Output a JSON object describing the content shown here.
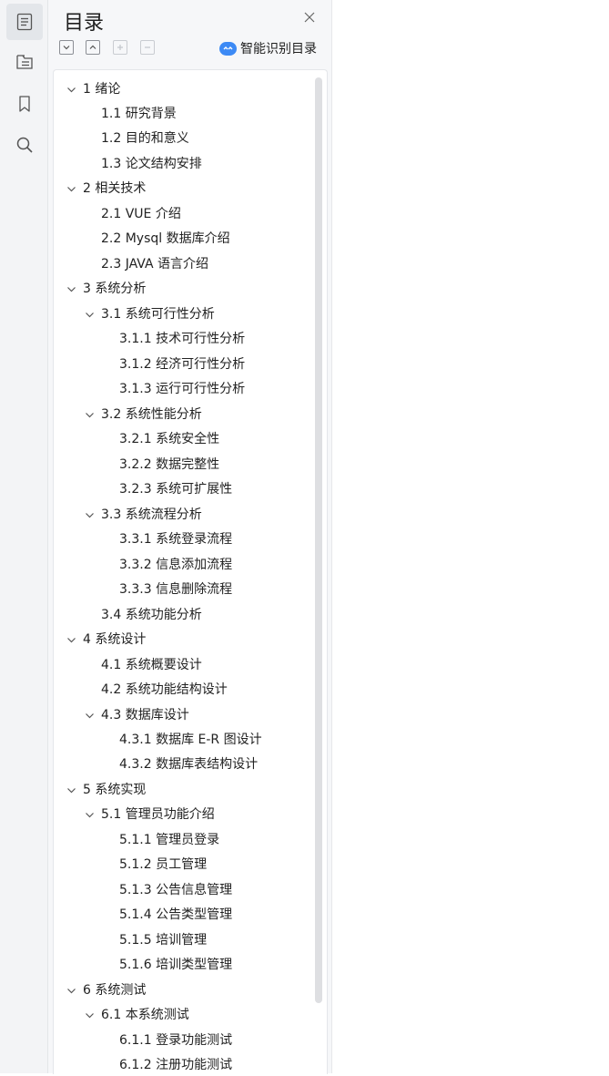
{
  "panel": {
    "title": "目录",
    "ai_label": "智能识别目录",
    "tools": [
      "collapse-all",
      "expand-all",
      "add-entry",
      "remove-entry"
    ]
  },
  "rail": [
    "outline-icon",
    "thumbnail-icon",
    "bookmark-icon",
    "search-icon"
  ],
  "colors": {
    "accent": "#3c8af5",
    "rail_bg": "#f3f4f6",
    "panel_bg": "#f6f7f9"
  },
  "toc": [
    {
      "label": "1  绪论",
      "level": 0,
      "expandable": true
    },
    {
      "label": "1.1  研究背景",
      "level": 1,
      "expandable": false
    },
    {
      "label": "1.2 目的和意义",
      "level": 1,
      "expandable": false
    },
    {
      "label": "1.3  论文结构安排",
      "level": 1,
      "expandable": false
    },
    {
      "label": "2  相关技术",
      "level": 0,
      "expandable": true
    },
    {
      "label": "2.1 VUE 介绍",
      "level": 1,
      "expandable": false
    },
    {
      "label": "2.2 Mysql 数据库介绍",
      "level": 1,
      "expandable": false
    },
    {
      "label": "2.3 JAVA 语言介绍",
      "level": 1,
      "expandable": false
    },
    {
      "label": "3  系统分析",
      "level": 0,
      "expandable": true
    },
    {
      "label": "3.1 系统可行性分析",
      "level": 1,
      "expandable": true
    },
    {
      "label": "3.1.1  技术可行性分析",
      "level": 2,
      "expandable": false
    },
    {
      "label": "3.1.2  经济可行性分析",
      "level": 2,
      "expandable": false
    },
    {
      "label": "3.1.3  运行可行性分析",
      "level": 2,
      "expandable": false
    },
    {
      "label": "3.2 系统性能分析",
      "level": 1,
      "expandable": true
    },
    {
      "label": "3.2.1  系统安全性",
      "level": 2,
      "expandable": false
    },
    {
      "label": "3.2.2  数据完整性",
      "level": 2,
      "expandable": false
    },
    {
      "label": "3.2.3 系统可扩展性",
      "level": 2,
      "expandable": false
    },
    {
      "label": "3.3 系统流程分析",
      "level": 1,
      "expandable": true
    },
    {
      "label": "3.3.1 系统登录流程",
      "level": 2,
      "expandable": false
    },
    {
      "label": "3.3.2 信息添加流程",
      "level": 2,
      "expandable": false
    },
    {
      "label": "3.3.3 信息删除流程",
      "level": 2,
      "expandable": false
    },
    {
      "label": "3.4 系统功能分析",
      "level": 1,
      "expandable": false
    },
    {
      "label": "4  系统设计",
      "level": 0,
      "expandable": true
    },
    {
      "label": "4.1 系统概要设计",
      "level": 1,
      "expandable": false
    },
    {
      "label": "4.2 系统功能结构设计",
      "level": 1,
      "expandable": false
    },
    {
      "label": "4.3 数据库设计",
      "level": 1,
      "expandable": true
    },
    {
      "label": "4.3.1 数据库 E-R 图设计",
      "level": 2,
      "expandable": false
    },
    {
      "label": "4.3.2  数据库表结构设计",
      "level": 2,
      "expandable": false
    },
    {
      "label": "5  系统实现",
      "level": 0,
      "expandable": true
    },
    {
      "label": "5.1 管理员功能介绍",
      "level": 1,
      "expandable": true
    },
    {
      "label": "5.1.1 管理员登录",
      "level": 2,
      "expandable": false
    },
    {
      "label": "5.1.2  员工管理",
      "level": 2,
      "expandable": false
    },
    {
      "label": "5.1.3  公告信息管理",
      "level": 2,
      "expandable": false
    },
    {
      "label": "5.1.4 公告类型管理",
      "level": 2,
      "expandable": false
    },
    {
      "label": "5.1.5  培训管理",
      "level": 2,
      "expandable": false
    },
    {
      "label": "5.1.6  培训类型管理",
      "level": 2,
      "expandable": false
    },
    {
      "label": "6 系统测试",
      "level": 0,
      "expandable": true
    },
    {
      "label": "6.1  本系统测试",
      "level": 1,
      "expandable": true
    },
    {
      "label": "6.1.1  登录功能测试",
      "level": 2,
      "expandable": false
    },
    {
      "label": "6.1.2  注册功能测试",
      "level": 2,
      "expandable": false
    }
  ]
}
